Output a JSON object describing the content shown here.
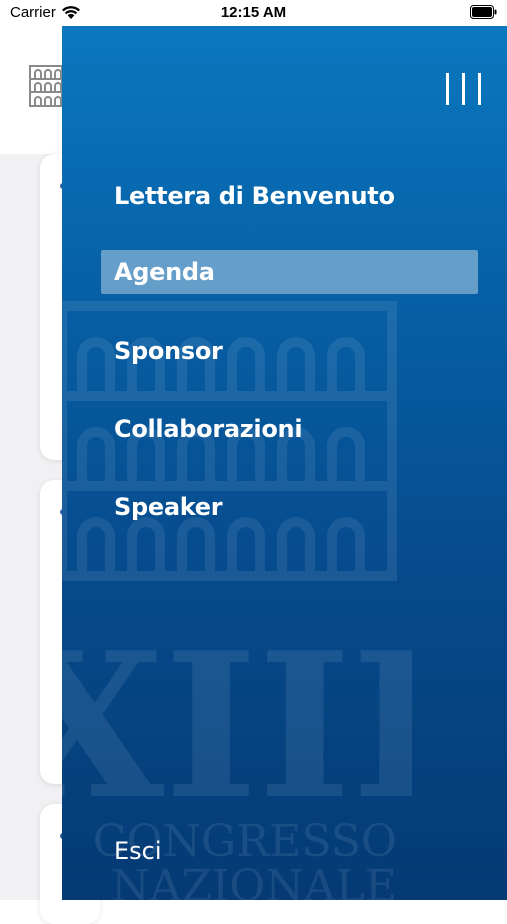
{
  "status_bar": {
    "carrier": "Carrier",
    "time": "12:15 AM",
    "wifi_icon": "wifi-icon",
    "battery_icon": "battery-icon"
  },
  "drawer": {
    "menu_icon": "menu-bars-icon",
    "items": [
      {
        "label": "Lettera di Benvenuto",
        "active": false
      },
      {
        "label": "Agenda",
        "active": true
      },
      {
        "label": "Sponsor",
        "active": false
      },
      {
        "label": "Collaborazioni",
        "active": false
      },
      {
        "label": "Speaker",
        "active": false
      }
    ],
    "logout_label": "Esci",
    "watermark": {
      "numeral": "XIII",
      "line1": "CONGRESSO",
      "line2": "NAZIONALE"
    }
  },
  "underlay": {
    "logo_icon": "arena-logo-icon"
  },
  "colors": {
    "drawer_top": "#0a78bf",
    "drawer_bottom": "#053a74",
    "active_item": "#9fc3de",
    "background": "#f1f1f3"
  }
}
